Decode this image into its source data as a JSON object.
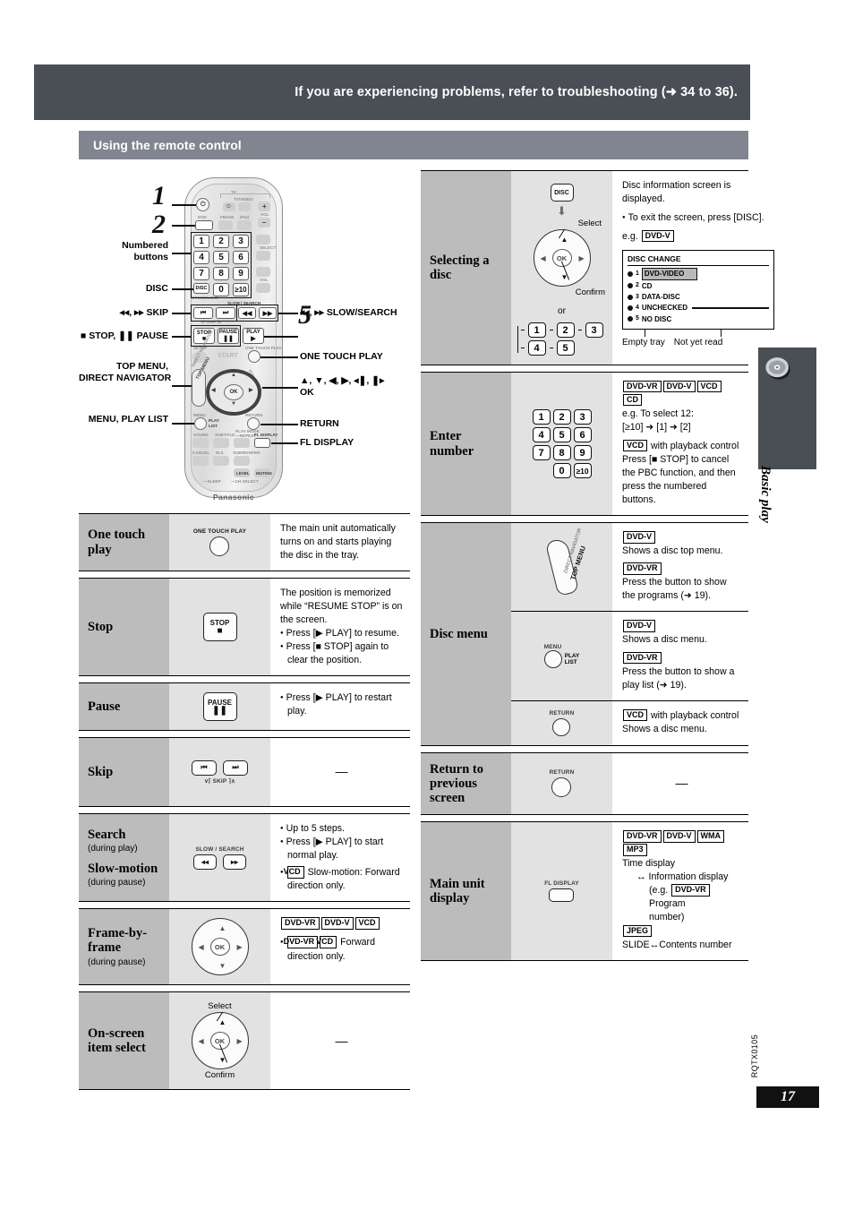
{
  "banner": {
    "text": "If you are experiencing problems, refer to troubleshooting (➜ 34 to 36)."
  },
  "section": {
    "title": "Using the remote control"
  },
  "remote": {
    "brand": "Panasonic",
    "steps": [
      "1",
      "2",
      "5"
    ],
    "callouts_left": [
      "Numbered\nbuttons",
      "DISC",
      "⏮, ⏭  SKIP",
      "■ STOP, ▐▐ PAUSE",
      "TOP MENU,\nDIRECT NAVIGATOR",
      "MENU, PLAY LIST"
    ],
    "callouts_left_flat": {
      "numbered_buttons_l1": "Numbered",
      "numbered_buttons_l2": "buttons",
      "disc": "DISC",
      "skip": "◂◂, ▸▸  SKIP",
      "stop_pause": "■ STOP, ❚❚ PAUSE",
      "top_menu_l1": "TOP MENU,",
      "top_menu_l2": "DIRECT NAVIGATOR",
      "menu_play_list": "MENU, PLAY LIST"
    },
    "callouts_right": {
      "slow_search": "◂◂, ▸▸ SLOW/SEARCH",
      "one_touch_play": "ONE TOUCH PLAY",
      "arrows_l1": "▲, ▼, ◀, ▶, ◂❚, ❚▸",
      "arrows_l2": "OK",
      "return": "RETURN",
      "fl_display": "FL DISPLAY"
    },
    "keys": {
      "tv": "TV",
      "tv_video": "TV/VIDEO",
      "vol": "VOL",
      "dvd": "DVD",
      "fm_am": "FM/AM",
      "ipod": "iPod",
      "select": "SELECT",
      "num": [
        "1",
        "2",
        "3",
        "4",
        "5",
        "6",
        "7",
        "8",
        "9",
        "0",
        "≥10"
      ],
      "disc": "DISC",
      "open_close": "OPEN/CLOSE",
      "slow_search": "SLOW / SEARCH",
      "skip": "SKIP",
      "stop": "STOP",
      "pause": "PAUSE",
      "play": "PLAY",
      "setup": "SETUP",
      "start": "START",
      "one_touch_play": "ONE TOUCH PLAY",
      "direct_navigator": "DIRECT NAVIGATOR",
      "top_menu": "TOP MENU",
      "cinema": "CINEMA",
      "function": "FUNCTIONS",
      "ok": "OK",
      "menu": "MENU",
      "play_list_l1": "PLAY",
      "play_list_l2": "LIST",
      "return": "RETURN",
      "sound": "SOUND",
      "subtitle": "SUBTITLE",
      "play_mode": "PLAY MODE",
      "repeat": "—REPEAT",
      "fl_display": "FL DISPLAY",
      "cancel": "CANCEL",
      "ws": "W.S.",
      "subwoofer": "SUBWOOFER",
      "level": "LEVEL",
      "muting": "MUTING",
      "sleep": "—SLEEP",
      "ch_select": "—CH SELECT"
    }
  },
  "left_table": [
    {
      "label": "One touch\nplay",
      "label_l1": "One touch",
      "label_l2": "play",
      "icon": {
        "type": "round-button",
        "caption": "ONE TOUCH PLAY"
      },
      "desc_lines": [
        "The main unit automatically turns on and starts playing the disc in the tray."
      ]
    },
    {
      "label_l1": "Stop",
      "label_l2": "",
      "icon": {
        "type": "key",
        "caption": "STOP",
        "glyph": "■"
      },
      "desc_lines": [
        "The position is memorized while “RESUME STOP” is on the screen."
      ],
      "bullets": [
        "Press [▶ PLAY] to resume.",
        "Press [■ STOP] again to clear the position."
      ]
    },
    {
      "label_l1": "Pause",
      "label_l2": "",
      "icon": {
        "type": "key",
        "caption": "PAUSE",
        "glyph": "❚❚"
      },
      "bullets": [
        "Press [▶ PLAY] to restart play."
      ]
    },
    {
      "label_l1": "Skip",
      "label_l2": "",
      "icon": {
        "type": "skip-pair",
        "caption": "SKIP",
        "left": "⏮",
        "right": "⏭"
      },
      "desc_dash": "—"
    },
    {
      "label_l1": "Search",
      "sub_l1": "(during play)",
      "label_l2": "Slow-motion",
      "sub_l2": "(during pause)",
      "icon": {
        "type": "slow-search-pair",
        "caption": "SLOW / SEARCH",
        "left": "◂◂",
        "right": "▸▸"
      },
      "bullets": [
        "Up to 5 steps.",
        "Press [▶ PLAY] to start normal play."
      ],
      "bullets_badged": [
        {
          "badges": [
            "VCD"
          ],
          "text": "Slow-motion: Forward direction only."
        }
      ]
    },
    {
      "label_l1": "Frame-by-",
      "label_l2": "frame",
      "sub_l2": "(during pause)",
      "icon": {
        "type": "jog",
        "ok": "OK"
      },
      "badges": [
        "DVD-VR",
        "DVD-V",
        "VCD"
      ],
      "bullets_badged": [
        {
          "badges": [
            "DVD-VR",
            "VCD"
          ],
          "text": "Forward direction only."
        }
      ]
    },
    {
      "label_l1": "On-screen",
      "label_l2": "item select",
      "icon": {
        "type": "jog-labeled",
        "ok": "OK",
        "top_label": "Select",
        "bottom_label": "Confirm"
      },
      "desc_dash": "—"
    }
  ],
  "right_table": [
    {
      "label_l1": "Selecting a",
      "label_l2": "disc",
      "icon": {
        "type": "disc-select",
        "disc_key": "DISC",
        "select_label": "Select",
        "confirm_label": "Confirm",
        "or_label": "or",
        "numbers": [
          "1",
          "2",
          "3",
          "4",
          "5"
        ],
        "ok": "OK"
      },
      "desc_lines": [
        "Disc information screen is displayed."
      ],
      "bullets": [
        "To exit the screen, press [DISC]."
      ],
      "eg_label": "e.g.",
      "eg_badge": "DVD-V",
      "osd": {
        "title": "DISC CHANGE",
        "rows": [
          {
            "n": "1",
            "text": "DVD-VIDEO",
            "highlight": true
          },
          {
            "n": "2",
            "text": "CD",
            "highlight": false
          },
          {
            "n": "3",
            "text": "DATA-DISC",
            "highlight": false
          },
          {
            "n": "4",
            "text": "UNCHECKED",
            "highlight": false
          },
          {
            "n": "5",
            "text": "NO DISC",
            "highlight": false
          }
        ],
        "note_left": "Empty tray",
        "note_right": "Not yet read"
      }
    },
    {
      "label_l1": "Enter",
      "label_l2": "number",
      "icon": {
        "type": "numpad",
        "keys": [
          "1",
          "2",
          "3",
          "4",
          "5",
          "6",
          "7",
          "8",
          "9",
          "0",
          "≥10"
        ]
      },
      "badges": [
        "DVD-VR",
        "DVD-V",
        "VCD",
        "CD"
      ],
      "desc_lines": [
        "e.g. To select 12:",
        "[≥10] ➜ [1] ➜ [2]"
      ],
      "sub_blocks": [
        {
          "badges": [
            "VCD"
          ],
          "head": "with playback control",
          "text": "Press [■ STOP] to cancel the PBC function, and then press the numbered buttons."
        }
      ]
    },
    {
      "label_l1": "Disc menu",
      "label_l2": "",
      "subrows": [
        {
          "icon": {
            "type": "top-menu-key",
            "l1": "DIRECT NAVIGATOR",
            "l2": "TOP MENU"
          },
          "blocks": [
            {
              "badges": [
                "DVD-V"
              ],
              "text": "Shows a disc top menu."
            },
            {
              "badges": [
                "DVD-VR"
              ],
              "text": "Press the button to show the programs (➜ 19)."
            }
          ]
        },
        {
          "icon": {
            "type": "menu-round",
            "caption": "MENU",
            "sub_l1": "PLAY",
            "sub_l2": "LIST"
          },
          "blocks": [
            {
              "badges": [
                "DVD-V"
              ],
              "text": "Shows a disc menu."
            },
            {
              "badges": [
                "DVD-VR"
              ],
              "text": "Press the button to show a play list (➜ 19)."
            }
          ]
        },
        {
          "icon": {
            "type": "return-round",
            "caption": "RETURN"
          },
          "blocks": [
            {
              "badges": [
                "VCD"
              ],
              "head": "with playback control",
              "text": "Shows a disc menu."
            }
          ]
        }
      ]
    },
    {
      "label_l1": "Return to",
      "label_l2": "previous",
      "label_l3": "screen",
      "icon": {
        "type": "return-round",
        "caption": "RETURN"
      },
      "desc_dash": "—"
    },
    {
      "label_l1": "Main unit",
      "label_l2": "display",
      "icon": {
        "type": "fl-display-key",
        "caption": "FL DISPLAY"
      },
      "badges": [
        "DVD-VR",
        "DVD-V",
        "WMA",
        "MP3"
      ],
      "desc_lines": [
        "Time display"
      ],
      "indent_lines": [
        {
          "text": "↔ Information display"
        },
        {
          "text": "(e.g. ",
          "badge": "DVD-VR",
          "tail": " Program"
        },
        {
          "text": "number)"
        }
      ],
      "badges2": [
        "JPEG"
      ],
      "tail_line": "SLIDE↔Contents number"
    }
  ],
  "margin": {
    "side_title": "Basic play",
    "doc_code": "RQTX0105",
    "page_number": "17"
  },
  "colors": {
    "banner_bg": "#4a4e55",
    "section_bg": "#808590",
    "label_cell_bg": "#bcbcbc",
    "icon_cell_bg": "#e2e2e2",
    "page_box_bg": "#111111"
  }
}
